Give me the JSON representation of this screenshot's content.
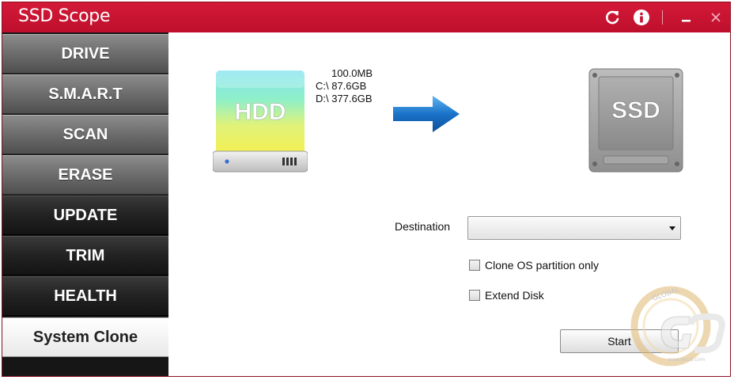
{
  "window": {
    "title": "SSD Scope",
    "controls": [
      "refresh-icon",
      "info-icon",
      "minimize-icon",
      "close-icon"
    ],
    "accent": "#c8102e"
  },
  "sidebar": {
    "items": [
      {
        "label": "DRIVE",
        "style": "light"
      },
      {
        "label": "S.M.A.R.T",
        "style": "light"
      },
      {
        "label": "SCAN",
        "style": "light"
      },
      {
        "label": "ERASE",
        "style": "light"
      },
      {
        "label": "UPDATE",
        "style": "dark"
      },
      {
        "label": "TRIM",
        "style": "dark"
      },
      {
        "label": "HEALTH",
        "style": "dark"
      },
      {
        "label": "System Clone",
        "style": "active"
      }
    ]
  },
  "source": {
    "label": "HDD",
    "partitions": [
      "100.0MB",
      "C:\\  87.6GB",
      "D:\\  377.6GB"
    ]
  },
  "target": {
    "label": "SSD"
  },
  "form": {
    "destination_label": "Destination",
    "destination_value": "",
    "options": [
      {
        "label": "Clone OS partition only",
        "checked": false
      },
      {
        "label": "Extend Disk",
        "checked": false
      }
    ],
    "start_label": "Start"
  },
  "watermark": {
    "text_top": "GLOBAL",
    "text_bottom": "www.gecid.com"
  }
}
